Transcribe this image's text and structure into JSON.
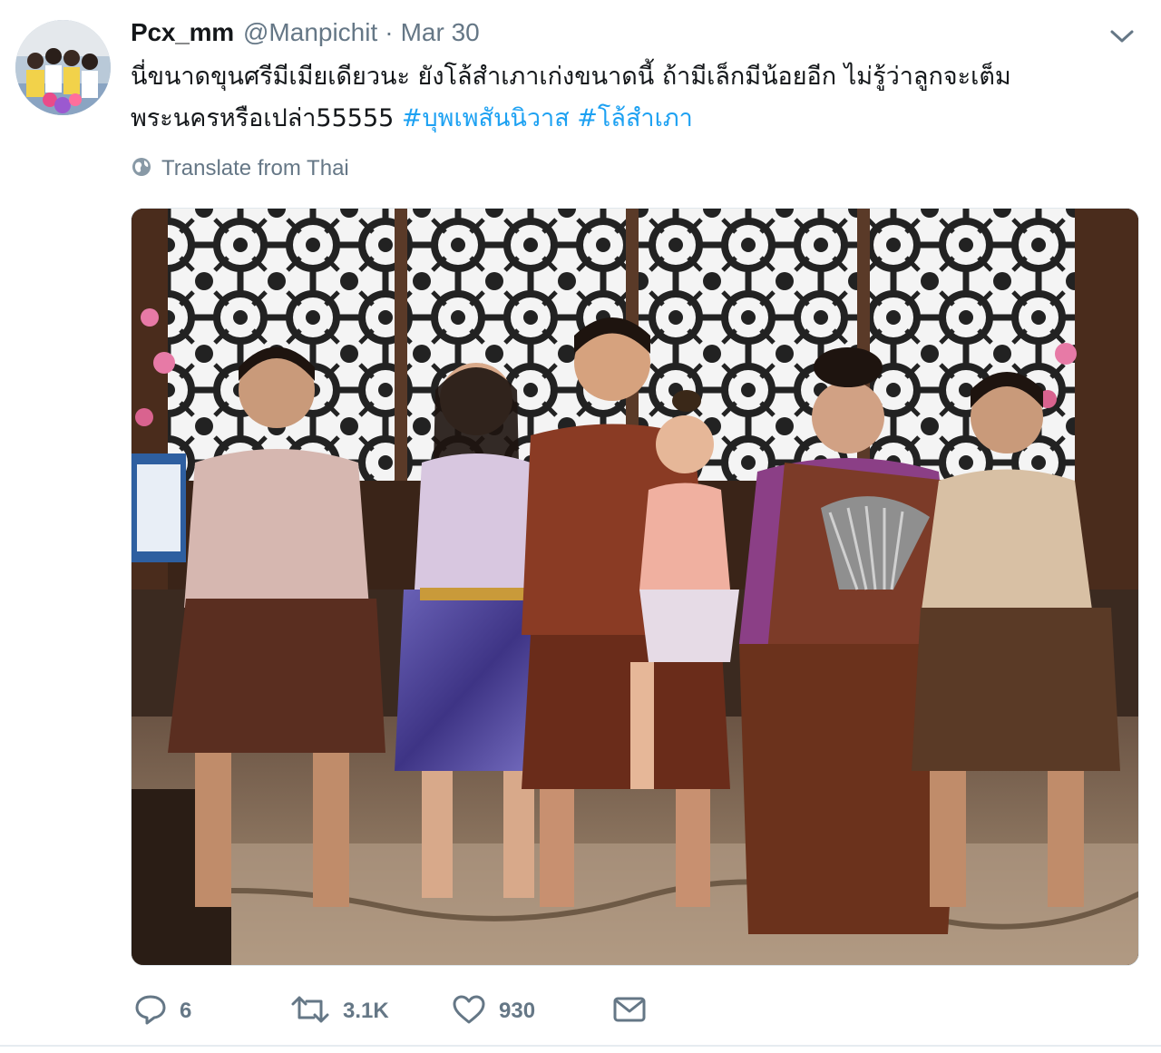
{
  "tweet": {
    "author": {
      "display_name": "Pcx_mm",
      "screen_name": "@Manpichit"
    },
    "separator": "·",
    "timestamp": "Mar 30",
    "text_lines": [
      "นี่ขนาดขุนศรีมีเมียเดียวนะ ยังโล้สำเภาเก่งขนาดนี้ ถ้ามีเล็กมีน้อยอีก ไม่รู้ว่าลูกจะเต็ม",
      "พระนครหรือเปล่า55555"
    ],
    "hashtags": [
      "#บุพเพสันนิวาส",
      "#โล้สำเภา"
    ],
    "translate_label": "Translate from Thai",
    "actions": {
      "reply_count": "6",
      "retweet_count": "3.1K",
      "like_count": "930"
    }
  },
  "icons": {
    "caret": "chevron-down-icon",
    "globe": "globe-icon",
    "reply": "reply-icon",
    "retweet": "retweet-icon",
    "like": "heart-icon",
    "dm": "envelope-icon"
  },
  "colors": {
    "text": "#14171a",
    "secondary": "#657786",
    "link": "#1da1f2",
    "divider": "#e6ecf0"
  }
}
